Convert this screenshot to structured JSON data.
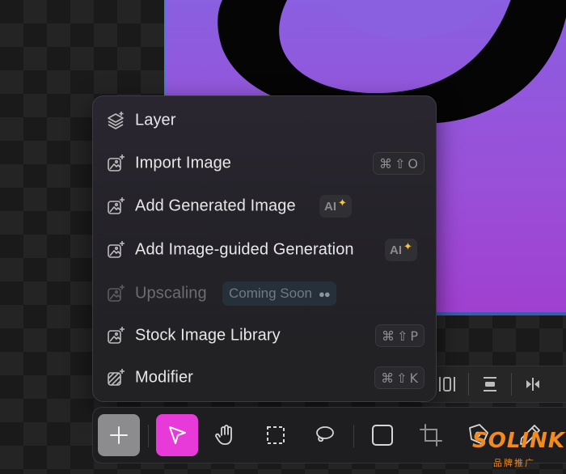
{
  "menu": {
    "items": [
      {
        "label": "Layer",
        "icon": "layers-icon"
      },
      {
        "label": "Import Image",
        "icon": "image-plus-icon",
        "shortcut": [
          "⌘",
          "⇧",
          "O"
        ]
      },
      {
        "label": "Add Generated Image",
        "icon": "image-plus-icon",
        "badge": "AI",
        "badge_icon": "sparkle-icon"
      },
      {
        "label": "Add Image-guided Generation",
        "icon": "image-plus-icon",
        "badge": "AI",
        "badge_icon": "sparkle-icon"
      },
      {
        "label": "Upscaling",
        "icon": "image-plus-icon",
        "disabled": true,
        "status": "Coming Soon",
        "status_icon": "eyes-icon"
      },
      {
        "label": "Stock Image Library",
        "icon": "image-plus-icon",
        "shortcut": [
          "⌘",
          "⇧",
          "P"
        ]
      },
      {
        "label": "Modifier",
        "icon": "hatched-square-icon",
        "shortcut": [
          "⌘",
          "⇧",
          "K"
        ]
      }
    ]
  },
  "toolbar": {
    "tools": [
      {
        "name": "add",
        "icon": "plus-icon",
        "active": true
      },
      {
        "name": "select",
        "icon": "cursor-icon",
        "selected": true,
        "accent": "#e83ad8"
      },
      {
        "name": "pan",
        "icon": "hand-icon"
      },
      {
        "name": "marquee",
        "icon": "dashed-square-icon"
      },
      {
        "name": "lasso",
        "icon": "lasso-icon"
      },
      {
        "name": "rectangle",
        "icon": "square-icon"
      },
      {
        "name": "crop",
        "icon": "crop-icon"
      },
      {
        "name": "pen",
        "icon": "pen-nib-icon"
      },
      {
        "name": "pencil",
        "icon": "pencil-icon"
      }
    ]
  },
  "align_toolbar": {
    "icons": [
      "align-center-vertical-icon",
      "align-middle-icon",
      "distribute-horizontal-icon"
    ]
  },
  "watermark": {
    "main": "SOLINK",
    "sub": "品牌推广"
  },
  "colors": {
    "canvas_purple": "#8a5fe0",
    "selection_blue": "#4a7bd8",
    "accent_magenta": "#e83ad8",
    "sparkle": "#f5c542"
  }
}
